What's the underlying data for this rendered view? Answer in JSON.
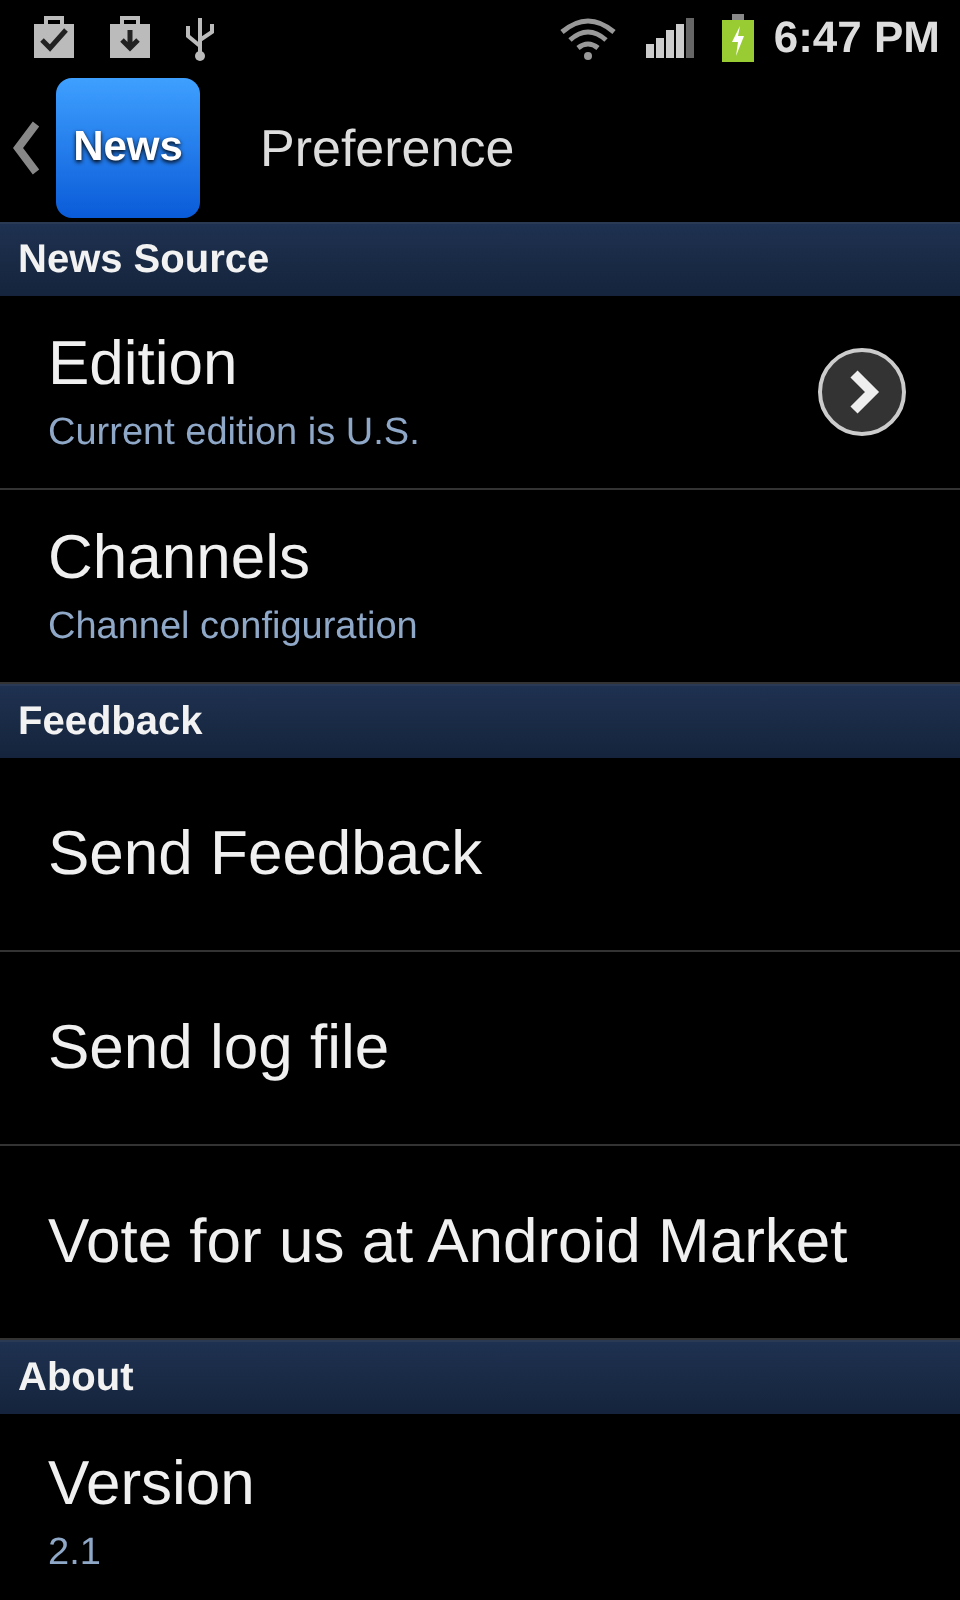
{
  "status_bar": {
    "time": "6:47 PM"
  },
  "header": {
    "app_icon_label": "News",
    "title": "Preference"
  },
  "sections": [
    {
      "title": "News Source",
      "items": [
        {
          "kind": "navigate",
          "title": "Edition",
          "summary": "Current edition is U.S."
        },
        {
          "kind": "plain",
          "title": "Channels",
          "summary": "Channel configuration"
        }
      ]
    },
    {
      "title": "Feedback",
      "items": [
        {
          "kind": "plain",
          "title": "Send Feedback"
        },
        {
          "kind": "plain",
          "title": "Send log file"
        },
        {
          "kind": "plain",
          "title": "Vote for us at Android Market"
        }
      ]
    },
    {
      "title": "About",
      "items": [
        {
          "kind": "plain",
          "title": "Version",
          "summary": "2.1"
        }
      ]
    }
  ]
}
